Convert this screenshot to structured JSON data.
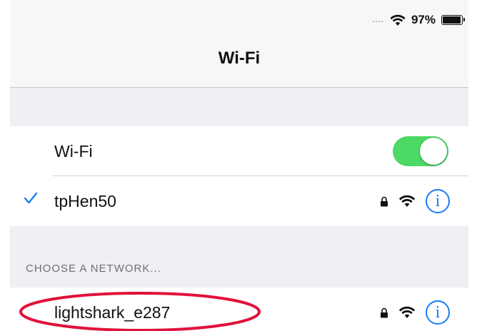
{
  "status_bar": {
    "signal": "....",
    "battery_text": "97%",
    "battery_level": 0.97
  },
  "nav": {
    "title": "Wi-Fi"
  },
  "wifi_toggle": {
    "label": "Wi-Fi",
    "on": true,
    "color": "#4cd964"
  },
  "connected_network": {
    "name": "tpHen50",
    "secured": true,
    "selected": true
  },
  "section": {
    "header": "CHOOSE A NETWORK..."
  },
  "networks": [
    {
      "name": "lightshark_e287",
      "secured": true
    }
  ],
  "icons": {
    "info": "i",
    "checkmark": "checkmark-icon",
    "lock": "lock-icon",
    "wifi": "wifi-icon"
  },
  "colors": {
    "accent": "#1a7cf5",
    "highlight": "#e0123a"
  }
}
